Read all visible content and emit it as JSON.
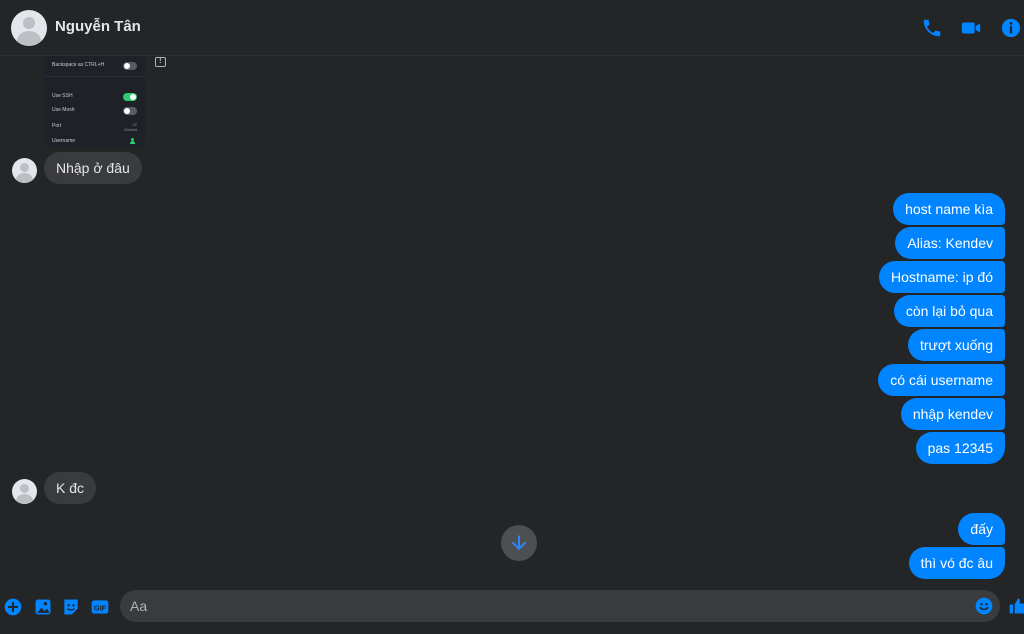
{
  "header": {
    "contact_name": "Nguyễn Tân",
    "icons": [
      "phone-icon",
      "video-camera-icon",
      "info-icon"
    ]
  },
  "shared_image": {
    "rows": [
      {
        "label": "Backspace as CTRL+H",
        "type": "toggle",
        "on": false
      },
      {
        "label": "Use SSH",
        "type": "toggle",
        "on": true
      },
      {
        "label": "Use Mosh",
        "type": "toggle",
        "on": false
      },
      {
        "label": "Port",
        "type": "value",
        "value": "22",
        "sub": "Default"
      },
      {
        "label": "Username",
        "type": "person"
      }
    ]
  },
  "messages": [
    {
      "side": "in",
      "text": "Nhập ở đâu"
    },
    {
      "side": "out",
      "text": "host name kìa"
    },
    {
      "side": "out",
      "text": "Alias: Kendev"
    },
    {
      "side": "out",
      "text": "Hostname: ip đó"
    },
    {
      "side": "out",
      "text": "còn lại bỏ qua"
    },
    {
      "side": "out",
      "text": "trượt xuống"
    },
    {
      "side": "out",
      "text": "có cái username"
    },
    {
      "side": "out",
      "text": "nhập kendev"
    },
    {
      "side": "out",
      "text": "pas 12345"
    },
    {
      "side": "in",
      "text": "K đc"
    },
    {
      "side": "out",
      "text": "đấy"
    },
    {
      "side": "out",
      "text": "thì vó đc âu"
    }
  ],
  "composer": {
    "placeholder": "Aa",
    "icons": [
      "plus-circle-icon",
      "image-icon",
      "sticker-icon",
      "gif-icon",
      "emoji-icon",
      "thumbs-up-icon"
    ]
  },
  "colors": {
    "accent": "#0084ff",
    "background": "#242526",
    "incoming_bubble": "#3a3b3c"
  }
}
